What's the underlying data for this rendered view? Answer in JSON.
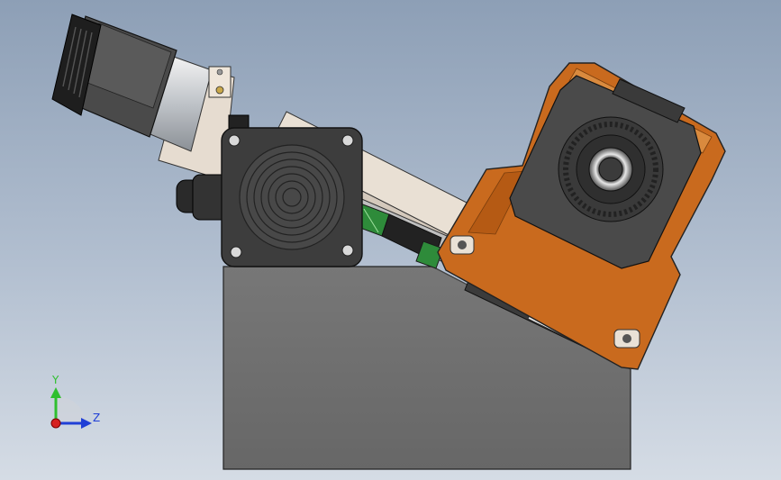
{
  "viewport": {
    "background_top": "#8d9fb6",
    "background_bottom": "#d5dce5"
  },
  "model": {
    "base_color": "#6e6e6e",
    "housing_color": "#c96a1e",
    "motor_color": "#3a3a3a",
    "plate_color": "#e6dcd0",
    "rail_green": "#2e8b3a"
  },
  "triad": {
    "y_label": "Y",
    "z_label": "Z",
    "y_color": "#2fbf2f",
    "z_color": "#1f3fd6",
    "x_color": "#d62020"
  }
}
